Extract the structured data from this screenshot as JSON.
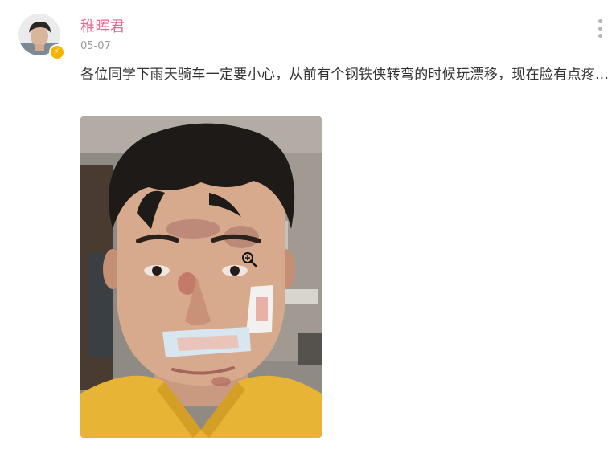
{
  "post": {
    "author_name": "稚晖君",
    "date": "05-07",
    "text": "各位同学下雨天骑车一定要小心，从前有个钢铁侠转弯的时候玩漂移，现在脸有点疼...",
    "badge_icon": "lightning-icon",
    "more_icon": "more-vertical-icon",
    "zoom_icon": "zoom-in-icon"
  },
  "colors": {
    "author_name": "#e8668c",
    "badge": "#f5b400",
    "date": "#9a9a9a",
    "text": "#333333"
  }
}
